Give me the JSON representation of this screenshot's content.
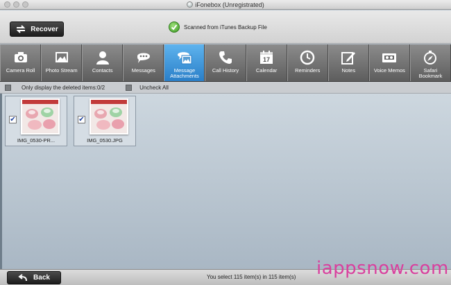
{
  "window": {
    "title": "iFonebox (Unregistrated)"
  },
  "toolbar": {
    "recover_label": "Recover",
    "scan_status": "Scanned from iTunes Backup File"
  },
  "tabs": [
    {
      "label": "Camera Roll",
      "icon": "camera-icon"
    },
    {
      "label": "Photo Stream",
      "icon": "photo-icon"
    },
    {
      "label": "Contacts",
      "icon": "contact-icon"
    },
    {
      "label": "Messages",
      "icon": "message-icon"
    },
    {
      "label": "Message\nAttachments",
      "icon": "attachment-icon",
      "active": true
    },
    {
      "label": "Call History",
      "icon": "phone-icon"
    },
    {
      "label": "Calendar",
      "icon": "calendar-icon"
    },
    {
      "label": "Reminders",
      "icon": "clock-icon"
    },
    {
      "label": "Notes",
      "icon": "note-icon"
    },
    {
      "label": "Voice Memos",
      "icon": "tape-icon"
    },
    {
      "label": "Safari\nBookmark",
      "icon": "compass-icon"
    }
  ],
  "calendar_day": "17",
  "filter": {
    "deleted_only_label": "Only display the deleted items:0/2",
    "uncheck_all_label": "Uncheck All"
  },
  "items": [
    {
      "name": "IMG_0530-PR...",
      "checked": true
    },
    {
      "name": "IMG_0530.JPG",
      "checked": true
    }
  ],
  "check_mark": "✔",
  "footer": {
    "back_label": "Back",
    "selection_status": "You select 115 item(s) in 115 item(s)"
  },
  "watermark": "iappsnow.com",
  "colors": {
    "active_tab": "#2a7fc8",
    "tab_bar": "#6d6d6d",
    "watermark": "#d9409e"
  }
}
